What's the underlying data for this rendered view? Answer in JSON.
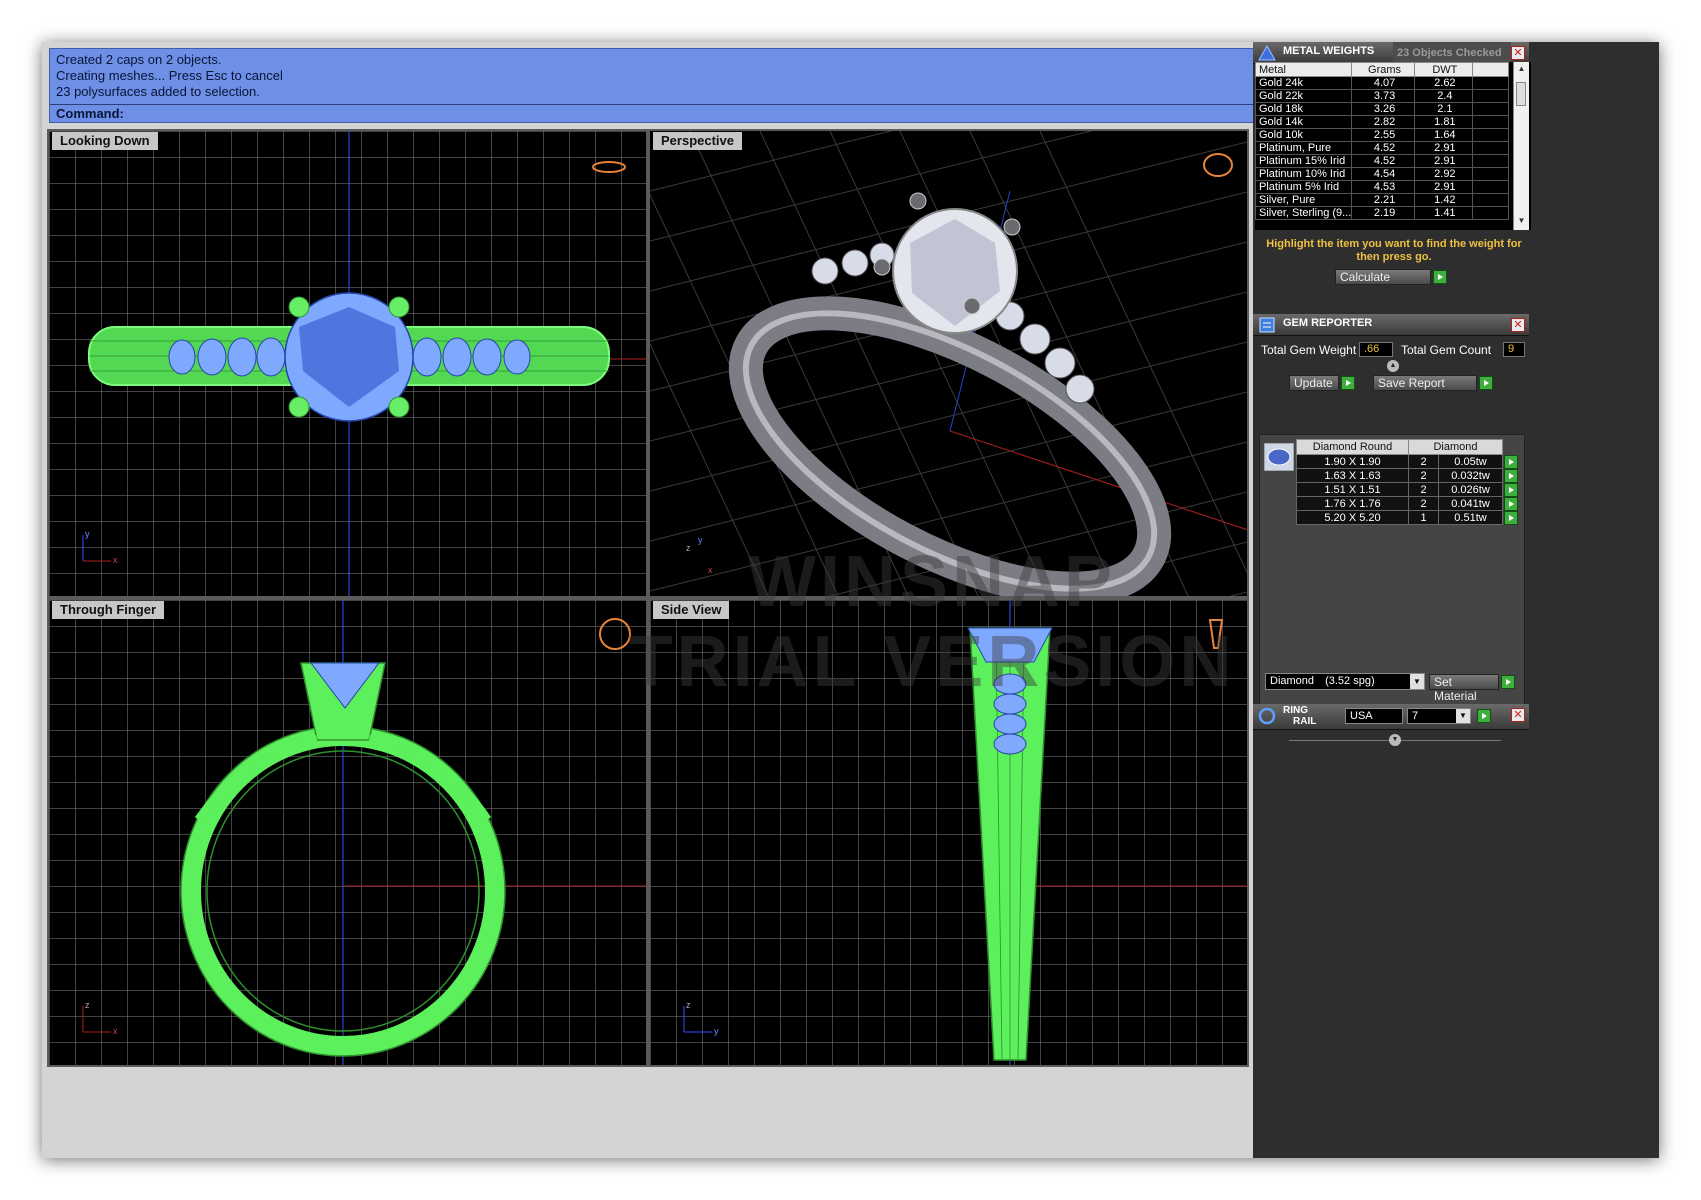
{
  "command": {
    "history": [
      "Created 2 caps on 2 objects.",
      "Creating meshes... Press Esc to cancel",
      "23 polysurfaces added to selection."
    ],
    "prompt_label": "Command:"
  },
  "viewports": {
    "top": {
      "title": "Looking Down",
      "axes": [
        "y",
        "x"
      ]
    },
    "perspective": {
      "title": "Perspective",
      "axes": [
        "z",
        "y",
        "x"
      ]
    },
    "finger": {
      "title": "Through Finger",
      "axes": [
        "z",
        "x"
      ]
    },
    "side": {
      "title": "Side View",
      "axes": [
        "z",
        "y"
      ]
    }
  },
  "watermark": [
    "WINSNAP",
    "TRIAL VERSION"
  ],
  "metal_weights": {
    "title": "METAL WEIGHTS",
    "status": "23 Objects Checked",
    "columns": [
      "Metal",
      "Grams",
      "DWT"
    ],
    "rows": [
      [
        "Gold 24k",
        "4.07",
        "2.62"
      ],
      [
        "Gold 22k",
        "3.73",
        "2.4"
      ],
      [
        "Gold 18k",
        "3.26",
        "2.1"
      ],
      [
        "Gold 14k",
        "2.82",
        "1.81"
      ],
      [
        "Gold 10k",
        "2.55",
        "1.64"
      ],
      [
        "Platinum, Pure",
        "4.52",
        "2.91"
      ],
      [
        "Platinum 15% Irid",
        "4.52",
        "2.91"
      ],
      [
        "Platinum 10% Irid",
        "4.54",
        "2.92"
      ],
      [
        "Platinum 5% Irid",
        "4.53",
        "2.91"
      ],
      [
        "Silver, Pure",
        "2.21",
        "1.42"
      ],
      [
        "Silver, Sterling (9...",
        "2.19",
        "1.41"
      ]
    ],
    "note": "Highlight the item you want to find the weight for then press go.",
    "calc_label": "Calculate"
  },
  "gem_reporter": {
    "title": "GEM REPORTER",
    "total_weight_label": "Total Gem Weight",
    "total_weight": ".66",
    "total_count_label": "Total Gem Count",
    "total_count": "9",
    "update_label": "Update",
    "save_label": "Save Report",
    "columns": [
      "Diamond Round",
      "Diamond"
    ],
    "rows": [
      [
        "1.90 X 1.90",
        "2",
        "0.05tw"
      ],
      [
        "1.63 X 1.63",
        "2",
        "0.032tw"
      ],
      [
        "1.51 X 1.51",
        "2",
        "0.026tw"
      ],
      [
        "1.76 X 1.76",
        "2",
        "0.041tw"
      ],
      [
        "5.20 X 5.20",
        "1",
        "0.51tw"
      ]
    ],
    "material": "Diamond",
    "material_sg": "(3.52 spg)",
    "set_material_label": "Set Material"
  },
  "ring_rail": {
    "title_line1": "RING",
    "title_line2": "RAIL",
    "region": "USA",
    "size": "7"
  },
  "colors": {
    "wire_green": "#5cf05c",
    "wire_blue": "#7fa8ff",
    "command_bg": "#6d90e6",
    "panel_bg": "#2e2e2e",
    "accent_orange": "#f0c040"
  }
}
